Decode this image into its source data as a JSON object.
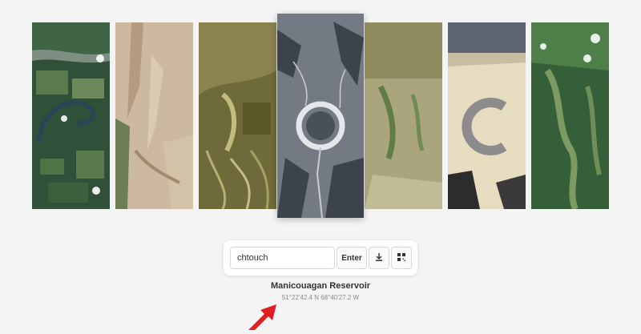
{
  "gallery": {
    "items": [
      {
        "id": "river-meander",
        "colors": [
          "#2f4a34",
          "#3c5c3f",
          "#6e8a63",
          "#2a3e4a"
        ]
      },
      {
        "id": "desert-sand",
        "colors": [
          "#c9b49b",
          "#d8c6ad",
          "#b89a7c",
          "#6b7d52"
        ]
      },
      {
        "id": "olive-delta",
        "colors": [
          "#7a7340",
          "#9b9458",
          "#5e5a2c",
          "#b7ae72"
        ]
      },
      {
        "id": "manicouagan",
        "colors": [
          "#3d434c",
          "#8d949c",
          "#c7ccd1",
          "#5a616a"
        ]
      },
      {
        "id": "green-valley",
        "colors": [
          "#a7a27b",
          "#bfb993",
          "#6e8752",
          "#8c8a5e"
        ]
      },
      {
        "id": "playa-arc",
        "colors": [
          "#e6dcc0",
          "#c7bda2",
          "#2c2c2c",
          "#6d7480"
        ]
      },
      {
        "id": "forest",
        "colors": [
          "#2e5a33",
          "#4a7a43",
          "#7c9a62",
          "#e8eee8"
        ]
      }
    ]
  },
  "search": {
    "value": "chtouch",
    "enter_label": "Enter"
  },
  "icons": {
    "download": "download-icon",
    "qr": "qr-code-icon"
  },
  "location": {
    "name": "Manicouagan Reservoir",
    "coords": "51°22'42.4 N 68°40'27.2 W"
  },
  "accent": "#e02020"
}
